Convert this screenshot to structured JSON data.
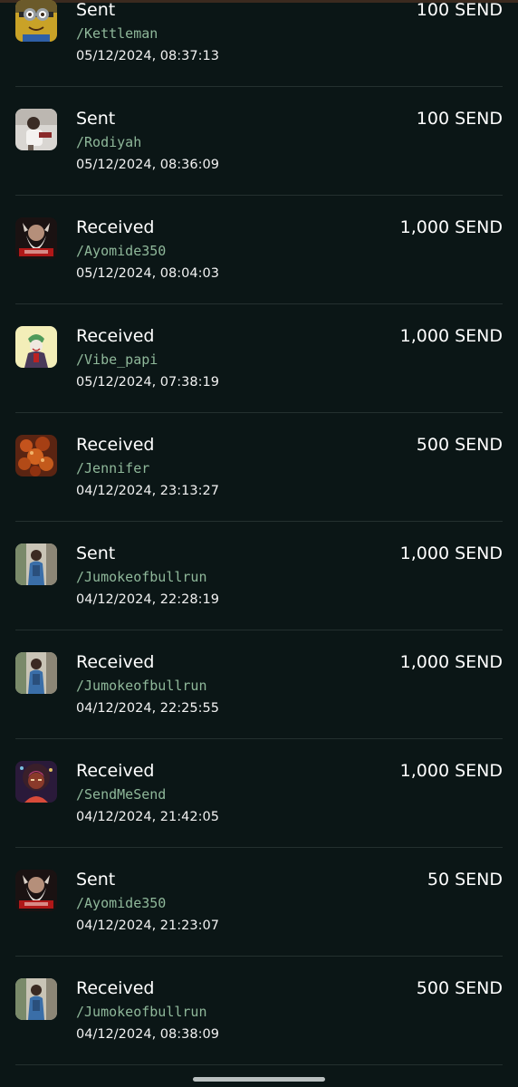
{
  "transactions": [
    {
      "type": "Sent",
      "handle": "/Kettleman",
      "time": "05/12/2024, 08:37:13",
      "amount": "100 SEND",
      "avatar_icon": "minion-avatar-icon"
    },
    {
      "type": "Sent",
      "handle": "/Rodiyah",
      "time": "05/12/2024, 08:36:09",
      "amount": "100 SEND",
      "avatar_icon": "photo-avatar-icon"
    },
    {
      "type": "Received",
      "handle": "/Ayomide350",
      "time": "05/12/2024, 08:04:03",
      "amount": "1,000 SEND",
      "avatar_icon": "bearded-man-avatar-icon"
    },
    {
      "type": "Received",
      "handle": "/Vibe_papi",
      "time": "05/12/2024, 07:38:19",
      "amount": "1,000 SEND",
      "avatar_icon": "joker-avatar-icon"
    },
    {
      "type": "Received",
      "handle": "/Jennifer",
      "time": "04/12/2024, 23:13:27",
      "amount": "500 SEND",
      "avatar_icon": "food-avatar-icon"
    },
    {
      "type": "Sent",
      "handle": "/Jumokeofbullrun",
      "time": "04/12/2024, 22:28:19",
      "amount": "1,000 SEND",
      "avatar_icon": "woman-avatar-icon"
    },
    {
      "type": "Received",
      "handle": "/Jumokeofbullrun",
      "time": "04/12/2024, 22:25:55",
      "amount": "1,000 SEND",
      "avatar_icon": "woman-avatar-icon"
    },
    {
      "type": "Received",
      "handle": "/SendMeSend",
      "time": "04/12/2024, 21:42:05",
      "amount": "1,000 SEND",
      "avatar_icon": "illustrated-woman-avatar-icon"
    },
    {
      "type": "Sent",
      "handle": "/Ayomide350",
      "time": "04/12/2024, 21:23:07",
      "amount": "50 SEND",
      "avatar_icon": "bearded-man-avatar-icon"
    },
    {
      "type": "Received",
      "handle": "/Jumokeofbullrun",
      "time": "04/12/2024, 08:38:09",
      "amount": "500 SEND",
      "avatar_icon": "woman-avatar-icon"
    }
  ]
}
